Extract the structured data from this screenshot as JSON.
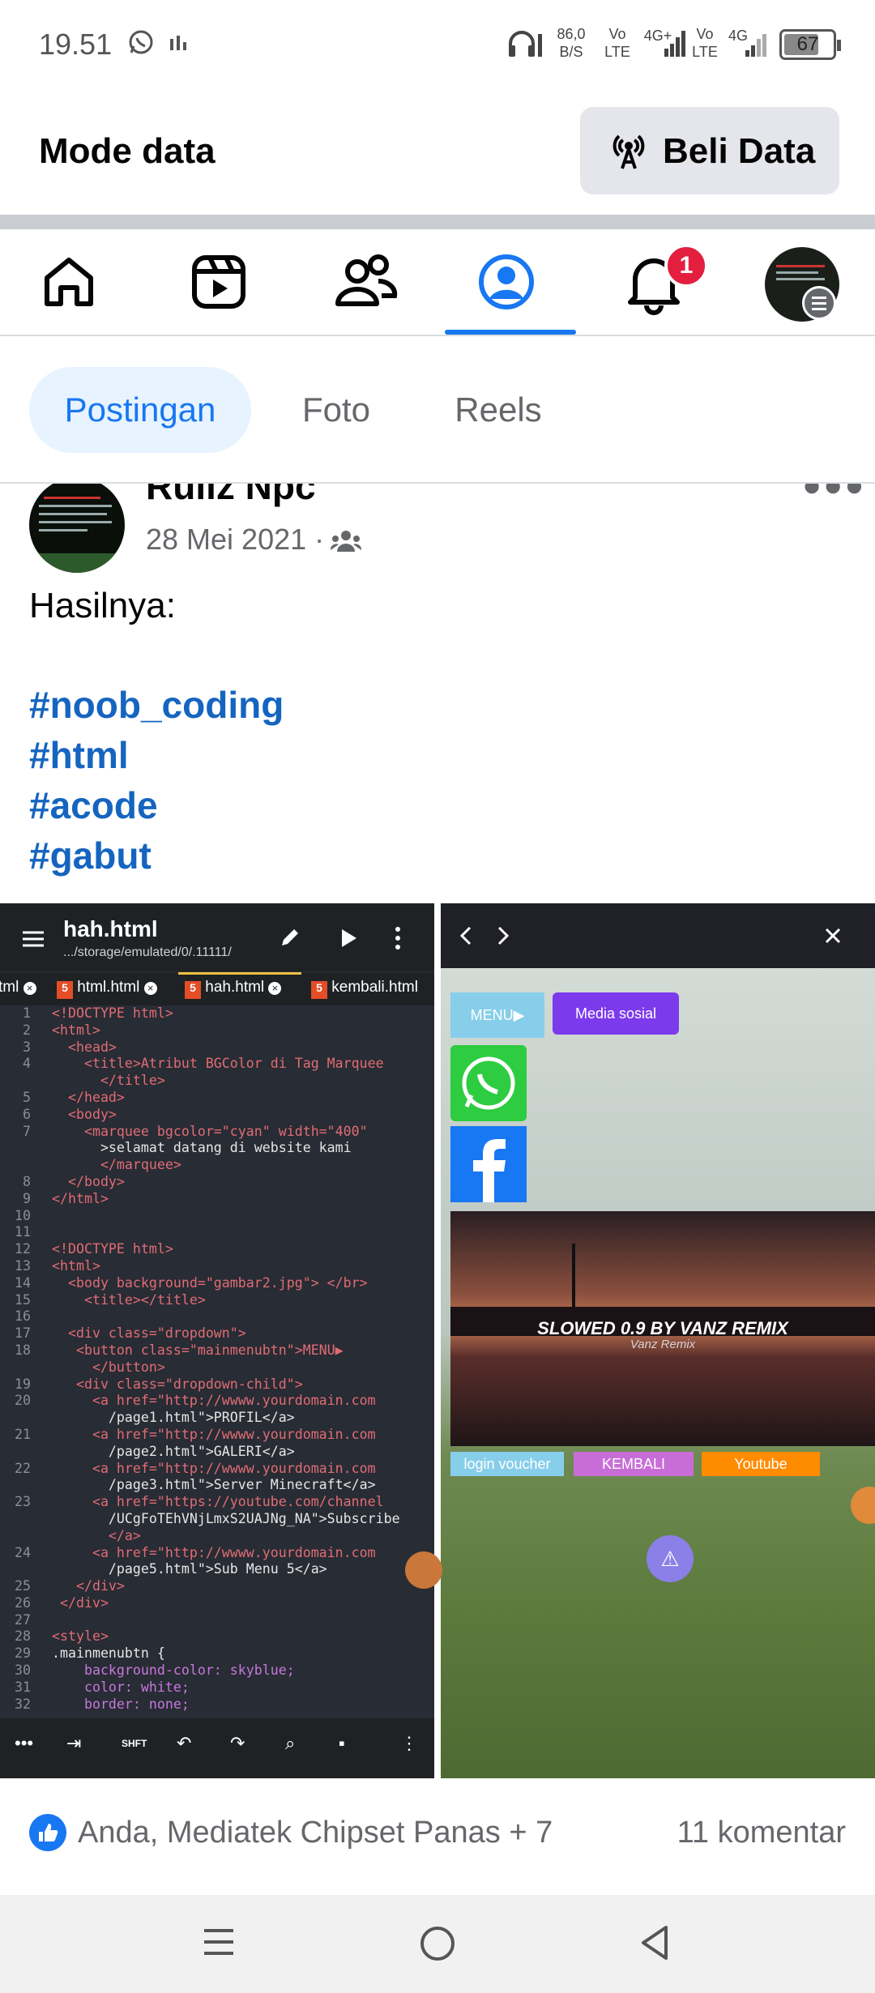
{
  "status_bar": {
    "time": "19.51",
    "net_speed_value": "86,0",
    "net_speed_unit": "B/S",
    "sim1_label_top": "Vo",
    "sim1_label_bottom": "LTE",
    "sim1_network": "4G+",
    "sim2_label_top": "Vo",
    "sim2_label_bottom": "LTE",
    "sim2_network": "4G",
    "battery": "67"
  },
  "mode_bar": {
    "title": "Mode data",
    "buy_button_label": "Beli Data"
  },
  "nav": {
    "items": [
      "home-icon",
      "video-icon",
      "friends-icon",
      "profile-icon",
      "notifications-icon",
      "menu-avatar"
    ],
    "active": "profile",
    "notification_count": "1",
    "accent_color": "#1877f2"
  },
  "profile_tabs": {
    "items": [
      {
        "label": "Postingan",
        "active": true
      },
      {
        "label": "Foto",
        "active": false
      },
      {
        "label": "Reels",
        "active": false
      }
    ]
  },
  "post": {
    "author": "Ruliz Npc",
    "date": "28 Mei 2021",
    "audience_icon": "friends-audience-icon",
    "text": "Hasilnya:",
    "hashtags": [
      "#noob_coding",
      "#html",
      "#acode",
      "#gabut"
    ],
    "hashtag_color": "#1565c0"
  },
  "editor_image": {
    "file_name": "hah.html",
    "file_path": ".../storage/emulated/0/.11111/",
    "tabs": [
      "tml",
      "html.html",
      "hah.html",
      "kembali.html"
    ],
    "code_lines": [
      {
        "n": "1",
        "t": "<!DOCTYPE html>"
      },
      {
        "n": "2",
        "t": "<html>"
      },
      {
        "n": "3",
        "t": "  <head>"
      },
      {
        "n": "4",
        "t": "    <title>Atribut BGColor di Tag Marquee"
      },
      {
        "n": "",
        "t": "      </title>"
      },
      {
        "n": "5",
        "t": "  </head>"
      },
      {
        "n": "6",
        "t": "  <body>"
      },
      {
        "n": "7",
        "t": "    <marquee bgcolor=\"cyan\" width=\"400\""
      },
      {
        "n": "",
        "t": "      >selamat datang di website kami"
      },
      {
        "n": "",
        "t": "      </marquee>"
      },
      {
        "n": "8",
        "t": "  </body>"
      },
      {
        "n": "9",
        "t": "</html>"
      },
      {
        "n": "10",
        "t": ""
      },
      {
        "n": "11",
        "t": ""
      },
      {
        "n": "12",
        "t": "<!DOCTYPE html>"
      },
      {
        "n": "13",
        "t": "<html>"
      },
      {
        "n": "14",
        "t": "  <body background=\"gambar2.jpg\"> </br>"
      },
      {
        "n": "15",
        "t": "    <title></title>"
      },
      {
        "n": "16",
        "t": ""
      },
      {
        "n": "17",
        "t": "  <div class=\"dropdown\">"
      },
      {
        "n": "18",
        "t": "   <button class=\"mainmenubtn\">MENU▶"
      },
      {
        "n": "",
        "t": "     </button>"
      },
      {
        "n": "19",
        "t": "   <div class=\"dropdown-child\">"
      },
      {
        "n": "20",
        "t": "     <a href=\"http://wwww.yourdomain.com"
      },
      {
        "n": "",
        "t": "       /page1.html\">PROFIL</a>"
      },
      {
        "n": "21",
        "t": "     <a href=\"http://wwww.yourdomain.com"
      },
      {
        "n": "",
        "t": "       /page2.html\">GALERI</a>"
      },
      {
        "n": "22",
        "t": "     <a href=\"http://wwww.yourdomain.com"
      },
      {
        "n": "",
        "t": "       /page3.html\">Server Minecraft</a>"
      },
      {
        "n": "23",
        "t": "     <a href=\"https://youtube.com/channel"
      },
      {
        "n": "",
        "t": "       /UCgFoTEhVNjLmxS2UAJNg_NA\">Subscribe"
      },
      {
        "n": "",
        "t": "       </a>"
      },
      {
        "n": "24",
        "t": "     <a href=\"http://wwww.yourdomain.com"
      },
      {
        "n": "",
        "t": "       /page5.html\">Sub Menu 5</a>"
      },
      {
        "n": "25",
        "t": "   </div>"
      },
      {
        "n": "26",
        "t": " </div>"
      },
      {
        "n": "27",
        "t": ""
      },
      {
        "n": "28",
        "t": "<style>"
      },
      {
        "n": "29",
        "t": ".mainmenubtn {"
      },
      {
        "n": "30",
        "t": "    background-color: skyblue;"
      },
      {
        "n": "31",
        "t": "    color: white;"
      },
      {
        "n": "32",
        "t": "    border: none;"
      }
    ],
    "toolbar": [
      "more",
      "tab",
      "shift",
      "undo",
      "redo",
      "search",
      "save",
      "menu"
    ],
    "shift_label": "SHFT"
  },
  "preview_image": {
    "menu_button": "MENU▶",
    "social_button": "Media sosial",
    "banner_title": "SLOWED 0.9 BY VANZ REMIX",
    "banner_subtitle": "Vanz Remix",
    "bottom_buttons": [
      "login voucher",
      "KEMBALI",
      "Youtube"
    ],
    "warning_glyph": "⚠"
  },
  "reactions": {
    "names": "Anda, Mediatek Chipset Panas + 7",
    "comments": "11 komentar"
  }
}
